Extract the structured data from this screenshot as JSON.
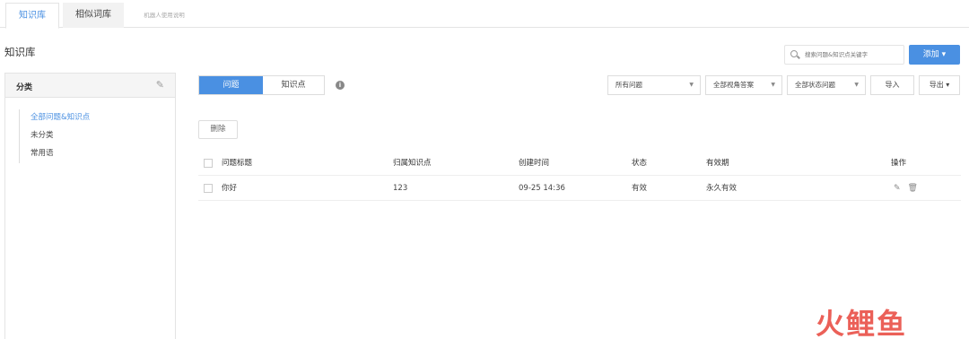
{
  "tabs": [
    {
      "label": "知识库"
    },
    {
      "label": "相似词库"
    },
    {
      "label": "机器人使用说明"
    }
  ],
  "page_title": "知识库",
  "search": {
    "placeholder": "搜索问题&知识点关键字"
  },
  "add_button": "添加",
  "sidebar": {
    "title": "分类",
    "items": [
      {
        "label": "全部问题&知识点"
      },
      {
        "label": "未分类"
      },
      {
        "label": "常用语"
      }
    ]
  },
  "segments": [
    "问题",
    "知识点"
  ],
  "filters": [
    "所有问题",
    "全部视角答案",
    "全部状态问题"
  ],
  "import_label": "导入",
  "export_label": "导出",
  "delete_label": "删除",
  "table": {
    "headers": [
      "问题标题",
      "归属知识点",
      "创建时间",
      "状态",
      "有效期",
      "操作"
    ],
    "rows": [
      [
        "你好",
        "123",
        "09-25 14:36",
        "有效",
        "永久有效"
      ]
    ]
  },
  "watermark": "火鲤鱼",
  "accent_color": "#4a90e2",
  "icons": [
    "search-icon",
    "edit-icon",
    "info-icon",
    "caret-down-icon",
    "delete-icon"
  ]
}
